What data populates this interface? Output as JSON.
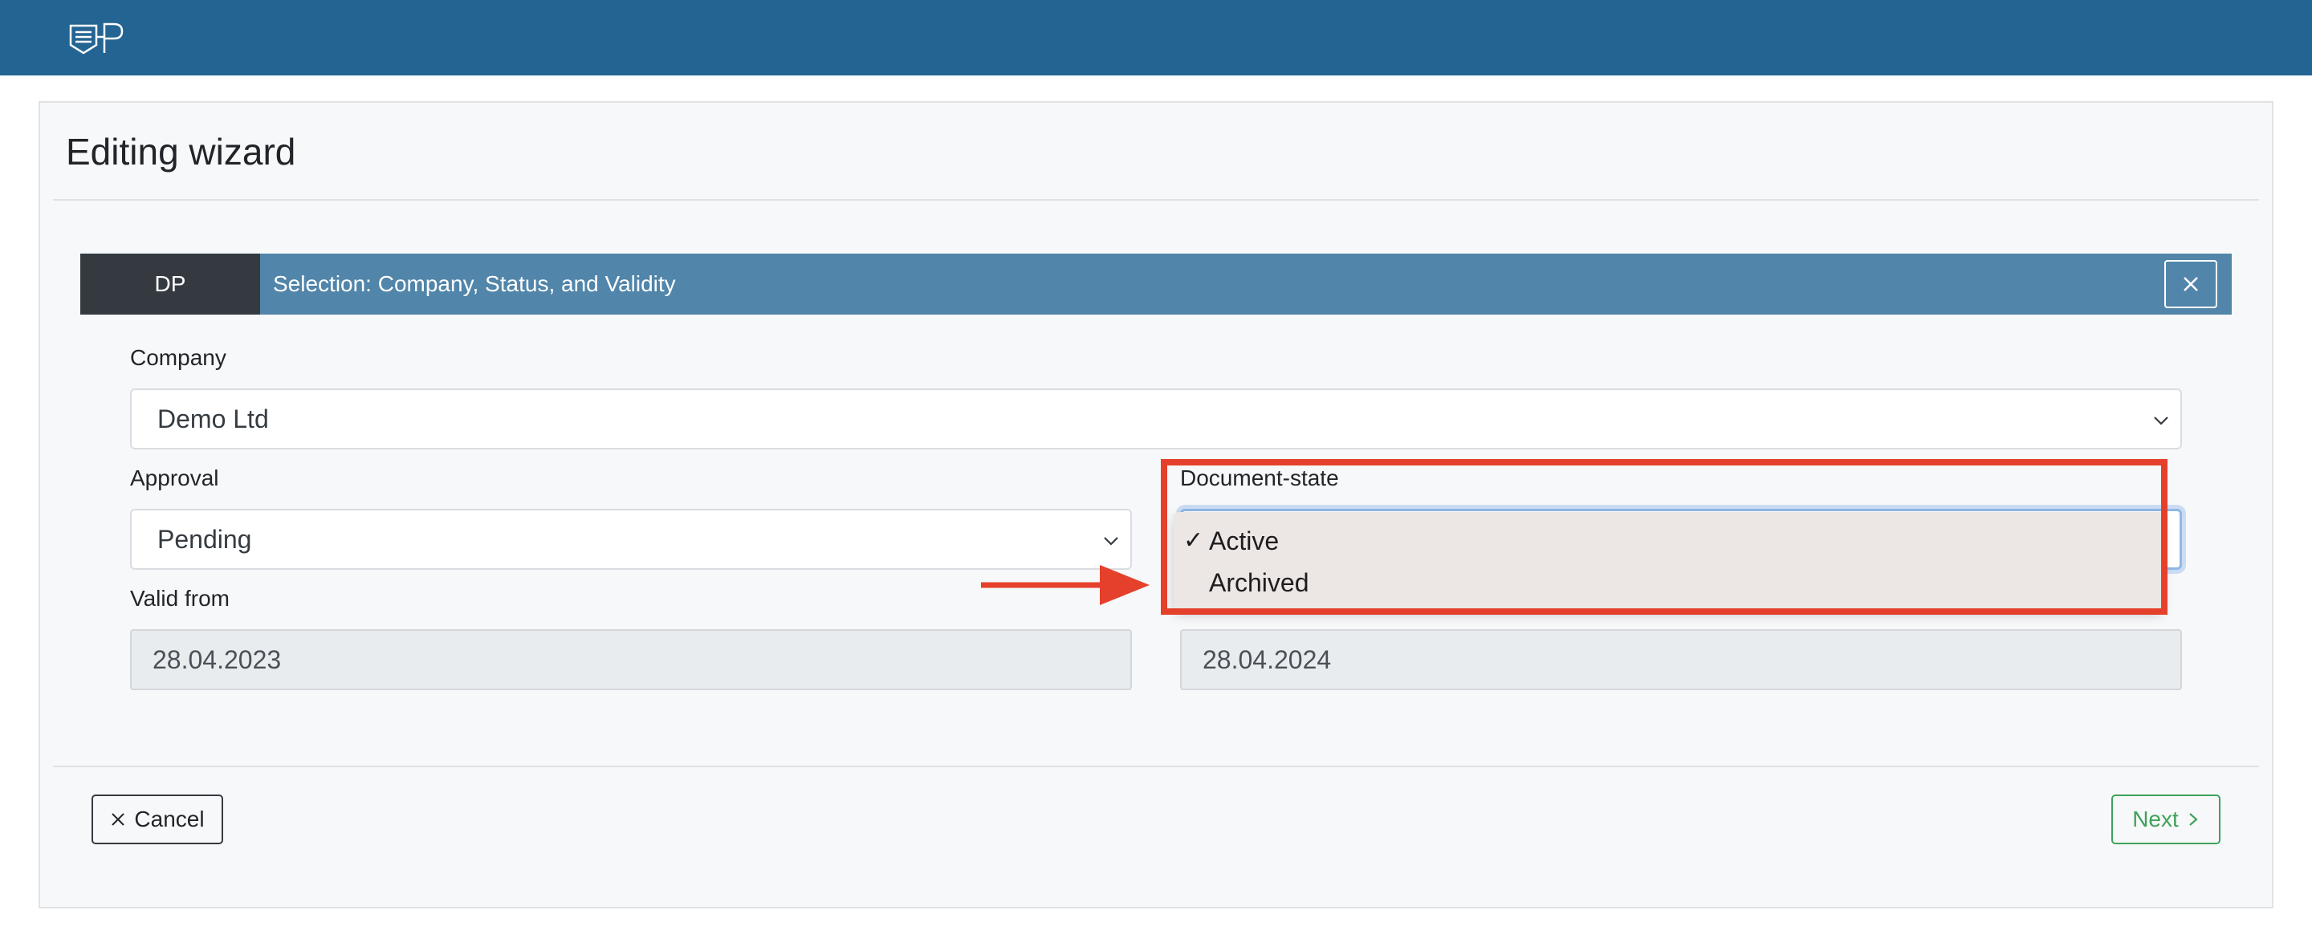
{
  "header": {
    "logo_icon": "dp-document-logo-icon"
  },
  "page": {
    "title": "Editing wizard"
  },
  "step": {
    "tag": "DP",
    "title": "Selection: Company, Status, and Validity",
    "close_icon": "close-icon"
  },
  "form": {
    "company": {
      "label": "Company",
      "value": "Demo Ltd"
    },
    "approval": {
      "label": "Approval",
      "value": "Pending"
    },
    "document_state": {
      "label": "Document-state",
      "options": [
        {
          "label": "Active",
          "selected": true
        },
        {
          "label": "Archived",
          "selected": false
        }
      ]
    },
    "valid_from": {
      "label": "Valid from",
      "value": "28.04.2023"
    },
    "valid_to": {
      "value": "28.04.2024"
    }
  },
  "annotation": {
    "highlight_color": "#e5402b"
  },
  "footer": {
    "cancel_label": "Cancel",
    "next_label": "Next"
  },
  "colors": {
    "topbar": "#246493",
    "step_bar": "#5185aa",
    "step_tag": "#343a40",
    "next_button": "#3fa25a"
  }
}
